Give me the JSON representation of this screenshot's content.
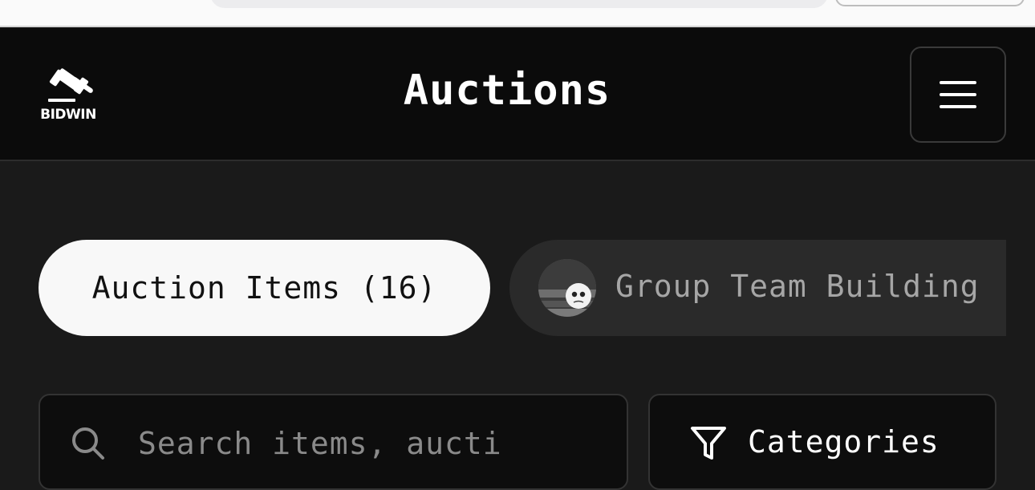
{
  "header": {
    "logo_text": "BIDWIN",
    "title": "Auctions",
    "menu_icon": "hamburger-menu-icon"
  },
  "tabs": [
    {
      "label": "Auction Items (16)",
      "active": true
    },
    {
      "label": "Group Team Building",
      "active": false,
      "icon": "group-avatar"
    }
  ],
  "search": {
    "placeholder": "Search items, aucti",
    "value": "",
    "icon": "search-icon"
  },
  "filters": {
    "categories_label": "Categories",
    "icon": "filter-icon"
  },
  "colors": {
    "header_bg": "#0b0b0b",
    "page_bg": "#1a1a1a",
    "active_tab_bg": "#f8f8f8",
    "inactive_tab_bg": "#2a2a2a",
    "inactive_tab_text": "#a6a6a6"
  }
}
